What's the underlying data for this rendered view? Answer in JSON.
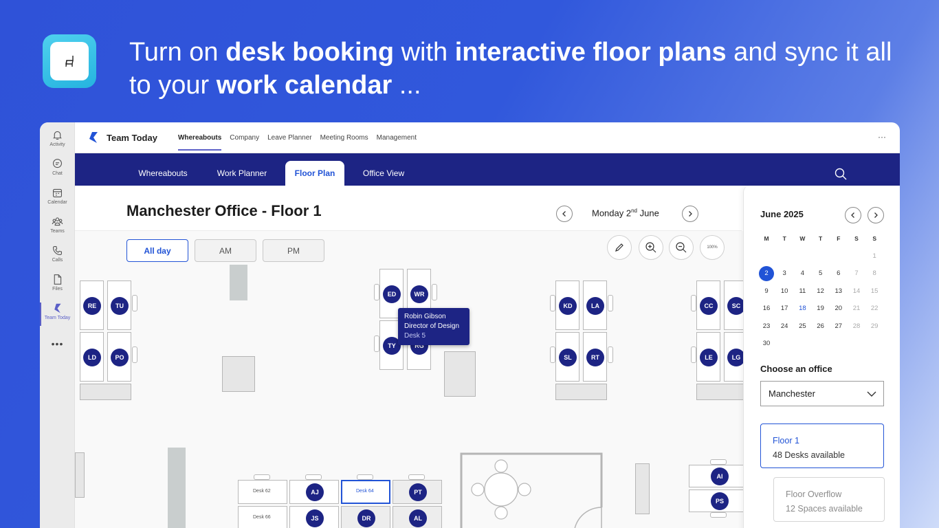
{
  "headline": {
    "p1": "Turn on ",
    "b1": "desk booking",
    "p2": " with ",
    "b2": "interactive floor plans",
    "p3": " and sync it all to your ",
    "b3": "work calendar",
    "p4": " ..."
  },
  "rail": [
    {
      "label": "Activity",
      "icon": "bell-icon"
    },
    {
      "label": "Chat",
      "icon": "chat-icon"
    },
    {
      "label": "Calendar",
      "icon": "calendar-icon"
    },
    {
      "label": "Teams",
      "icon": "teams-icon"
    },
    {
      "label": "Calls",
      "icon": "phone-icon"
    },
    {
      "label": "Files",
      "icon": "file-icon"
    },
    {
      "label": "Team Today",
      "icon": "team-today-icon"
    }
  ],
  "rail_more": "•••",
  "topbar": {
    "app_name": "Team Today",
    "tabs": [
      "Whereabouts",
      "Company",
      "Leave Planner",
      "Meeting Rooms",
      "Management"
    ],
    "more": "···"
  },
  "nav": {
    "tabs": [
      "Whereabouts",
      "Work Planner",
      "Floor Plan",
      "Office View"
    ],
    "active": "Floor Plan"
  },
  "floor_header": {
    "title": "Manchester Office - Floor 1",
    "date_day": "Monday 2",
    "date_sup": "nd",
    "date_month": " June"
  },
  "time_filter": {
    "options": [
      "All day",
      "AM",
      "PM"
    ],
    "active": "All day"
  },
  "zoom_label": "100%",
  "desks": {
    "re": "RE",
    "tu": "TU",
    "ld": "LD",
    "po": "PO",
    "ed": "ED",
    "wr": "WR",
    "ty": "TY",
    "rg": "RG",
    "kd": "KD",
    "la": "LA",
    "sl": "SL",
    "rt": "RT",
    "cc": "CC",
    "sc": "SC",
    "le": "LE",
    "lg": "LG",
    "aj": "AJ",
    "pt": "PT",
    "js": "JS",
    "dr": "DR",
    "al": "AL",
    "ai": "AI",
    "ps": "PS",
    "desk62": "Desk 62",
    "desk64": "Desk 64",
    "desk66": "Desk 66",
    "de_partial": "De"
  },
  "tooltip": {
    "name": "Robin Gibson",
    "role": "Director of Design",
    "desk": "Desk 5"
  },
  "calendar": {
    "month": "June 2025",
    "weekdays": [
      "M",
      "T",
      "W",
      "T",
      "F",
      "S",
      "S"
    ],
    "days": [
      "1",
      "2",
      "3",
      "4",
      "5",
      "6",
      "7",
      "8",
      "9",
      "10",
      "11",
      "12",
      "13",
      "14",
      "15",
      "16",
      "17",
      "18",
      "19",
      "20",
      "21",
      "22",
      "23",
      "24",
      "25",
      "26",
      "27",
      "28",
      "29",
      "30"
    ],
    "selected": "2",
    "today": "18"
  },
  "office": {
    "label": "Choose an office",
    "selected": "Manchester"
  },
  "floors": [
    {
      "name": "Floor 1",
      "sub": "48 Desks available"
    },
    {
      "name": "Floor Overflow",
      "sub": "12 Spaces available"
    }
  ],
  "colors": {
    "accent": "#2153d6",
    "navy": "#1d2484",
    "teams_purple": "#5b5fc7"
  }
}
